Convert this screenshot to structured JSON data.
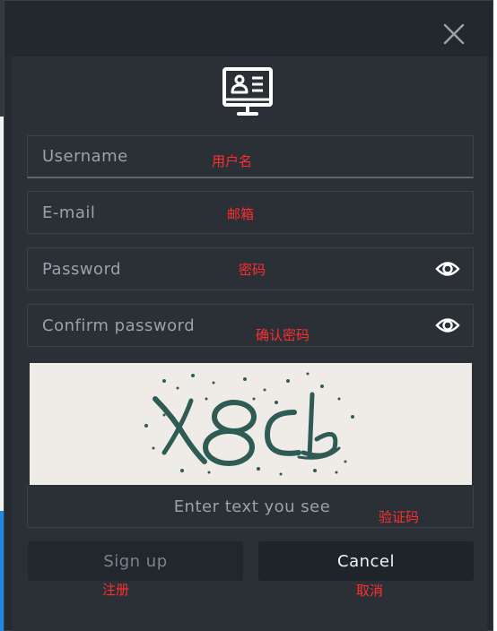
{
  "colors": {
    "dialog_bg": "#252a30",
    "panel_bg": "#2b3037",
    "field_border": "#3c424a",
    "annotation": "#ff2e2e",
    "captcha_bg": "#efebe6",
    "captcha_ink": "#2f5b55"
  },
  "icons": {
    "close": "close-icon",
    "header": "user-id-card-monitor-icon",
    "password_toggle": "eye-icon",
    "confirm_toggle": "eye-icon"
  },
  "form": {
    "username_placeholder": "Username",
    "email_placeholder": "E-mail",
    "password_placeholder": "Password",
    "confirm_placeholder": "Confirm password",
    "captcha_placeholder": "Enter text you see",
    "signup_label": "Sign up",
    "cancel_label": "Cancel"
  },
  "annotations": {
    "username": "用户名",
    "email": "邮箱",
    "password": "密码",
    "confirm": "确认密码",
    "captcha": "验证码",
    "signup": "注册",
    "cancel": "取消"
  }
}
